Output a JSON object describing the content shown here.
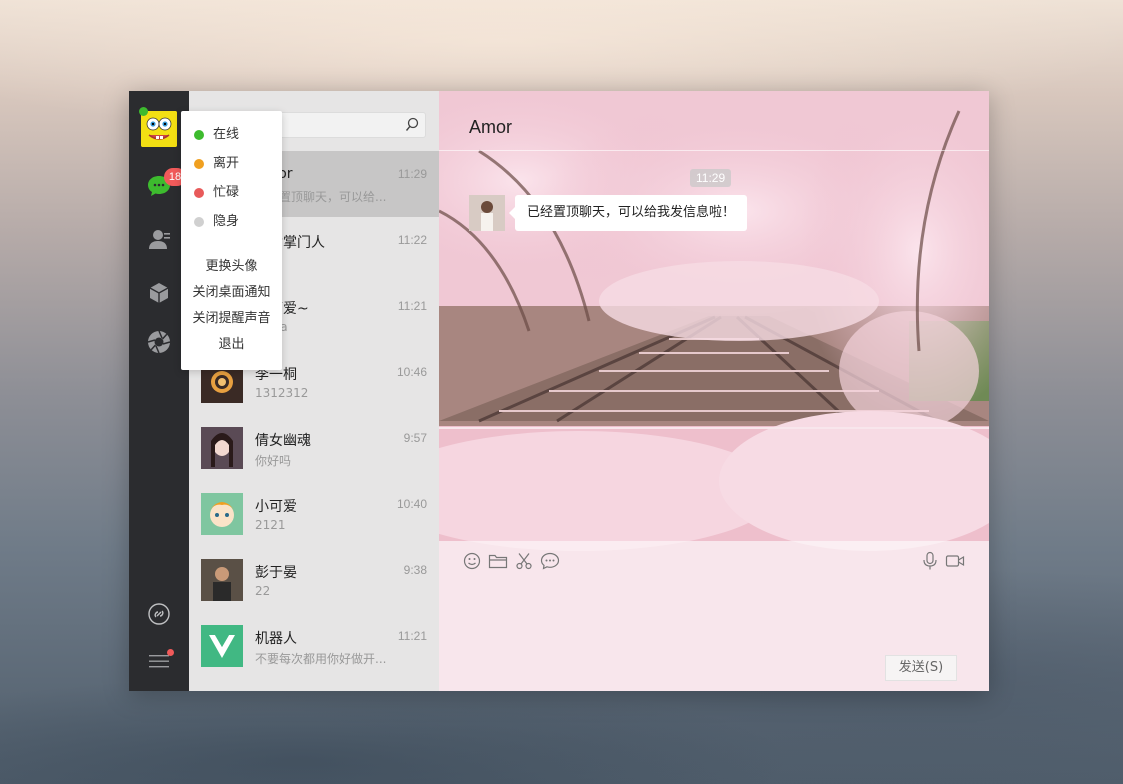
{
  "navbar": {
    "avatar": "spongebob-avatar",
    "unread_badge": "18",
    "icons": [
      "chat-icon",
      "contacts-icon",
      "box-icon",
      "aperture-icon",
      "link-icon",
      "menu-icon"
    ]
  },
  "status_menu": {
    "statuses": [
      {
        "label": "在线",
        "color": "#3dbb2e"
      },
      {
        "label": "离开",
        "color": "#f0a020"
      },
      {
        "label": "忙碌",
        "color": "#e85a5a"
      },
      {
        "label": "隐身",
        "color": "#d0d0d0"
      }
    ],
    "actions": [
      "更换头像",
      "关闭桌面通知",
      "关闭提醒声音",
      "退出"
    ]
  },
  "search": {
    "placeholder": "搜索"
  },
  "chats": [
    {
      "name": "Amor",
      "time": "11:29",
      "preview": "已经置顶聊天，可以给..."
    },
    {
      "name": "玉女掌门人",
      "time": "11:22",
      "preview": "哈哈"
    },
    {
      "name": "小可爱~",
      "time": "11:21",
      "preview": "soma"
    },
    {
      "name": "李一桐",
      "time": "10:46",
      "preview": "1312312"
    },
    {
      "name": "倩女幽魂",
      "time": "9:57",
      "preview": "你好吗"
    },
    {
      "name": "小可爱",
      "time": "10:40",
      "preview": "2121"
    },
    {
      "name": "彭于晏",
      "time": "9:38",
      "preview": "22"
    },
    {
      "name": "机器人",
      "time": "11:21",
      "preview": "不要每次都用你好做开..."
    }
  ],
  "conversation": {
    "title": "Amor",
    "timestamp": "11:29",
    "message": "已经置顶聊天，可以给我发信息啦！",
    "send_label": "发送(S)"
  },
  "colors": {
    "accent_green": "#3dbb2e",
    "badge_red": "#f15a5a",
    "nav_dark": "#2b2c2f"
  }
}
